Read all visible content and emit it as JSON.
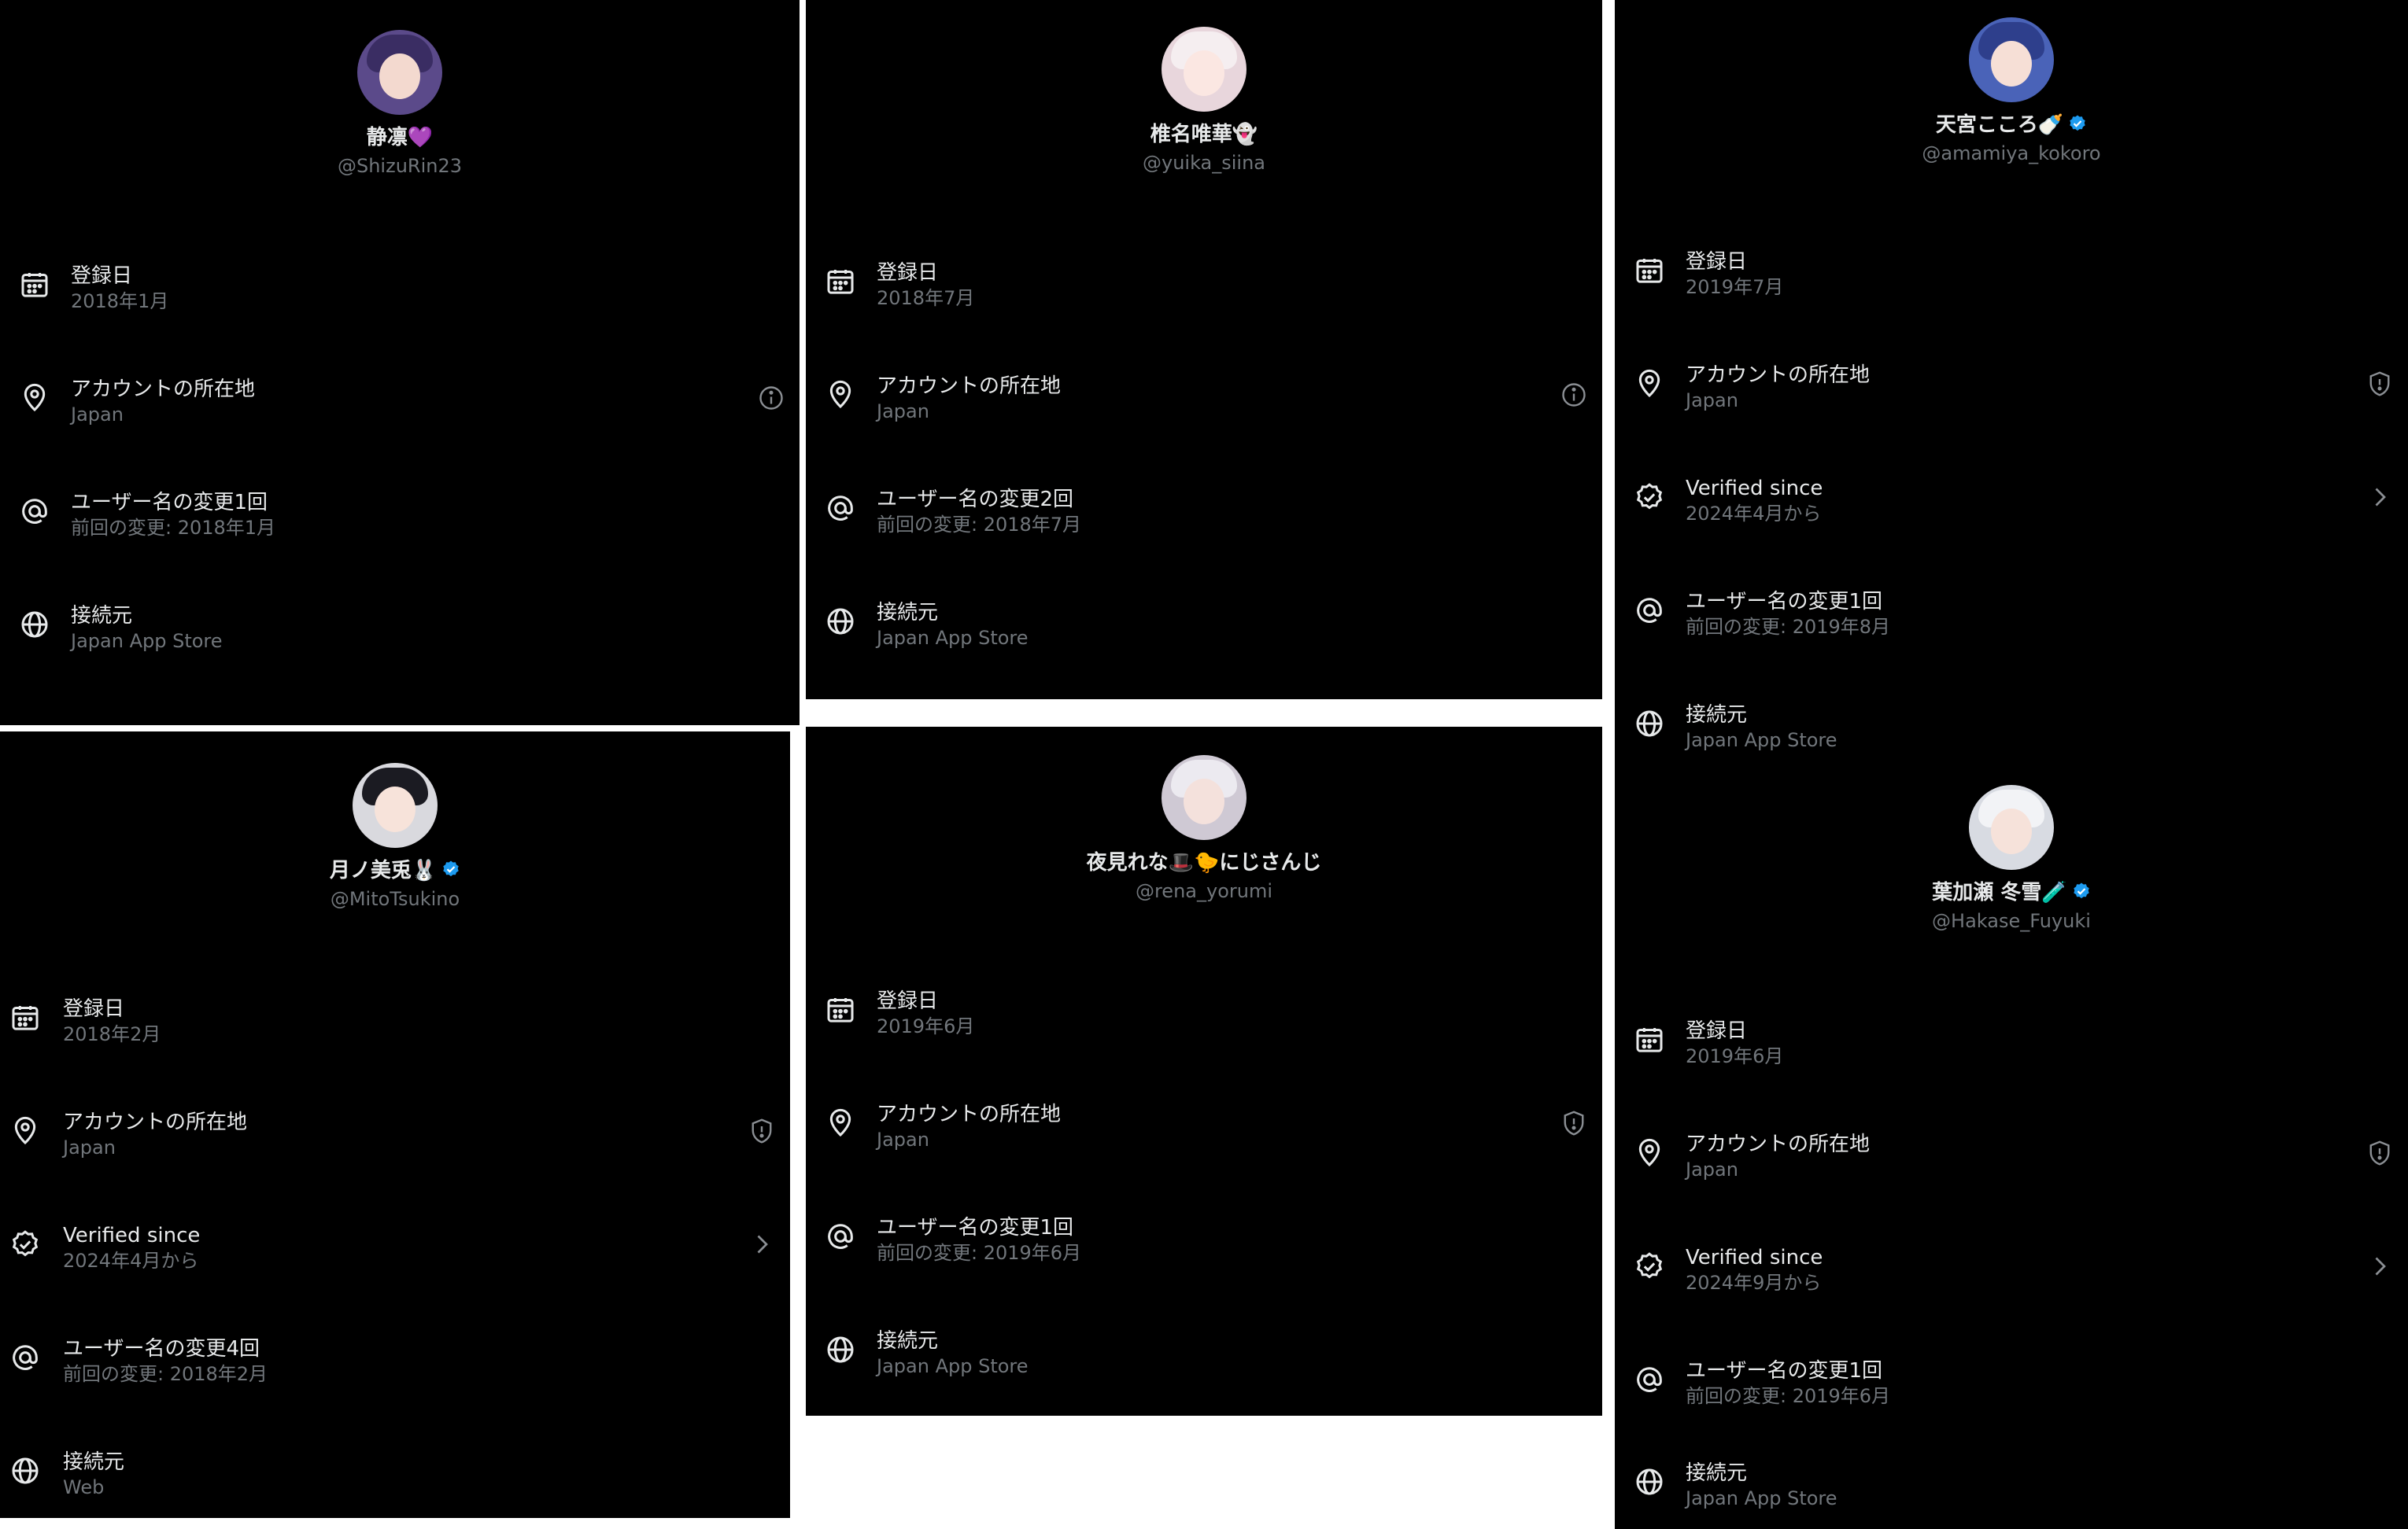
{
  "labels": {
    "joined": "登録日",
    "location": "アカウントの所在地",
    "verified": "Verified since",
    "connected": "接続元"
  },
  "profiles": [
    {
      "display_name": "静凛💜",
      "handle": "@ShizuRin23",
      "joined": "2018年1月",
      "location": "Japan",
      "username_changes": "ユーザー名の変更1回",
      "last_change": "前回の変更: 2018年1月",
      "connected_via": "Japan App Store"
    },
    {
      "display_name": "椎名唯華👻",
      "handle": "@yuika_siina",
      "joined": "2018年7月",
      "location": "Japan",
      "username_changes": "ユーザー名の変更2回",
      "last_change": "前回の変更: 2018年7月",
      "connected_via": "Japan App Store"
    },
    {
      "display_name": "天宮こころ🍼",
      "handle": "@amamiya_kokoro",
      "joined": "2019年7月",
      "location": "Japan",
      "verified_since": "2024年4月から",
      "username_changes": "ユーザー名の変更1回",
      "last_change": "前回の変更: 2019年8月",
      "connected_via": "Japan App Store"
    },
    {
      "display_name": "月ノ美兎🐰",
      "handle": "@MitoTsukino",
      "joined": "2018年2月",
      "location": "Japan",
      "verified_since": "2024年4月から",
      "username_changes": "ユーザー名の変更4回",
      "last_change": "前回の変更: 2018年2月",
      "connected_via": "Web"
    },
    {
      "display_name": "夜見れな🎩🐤にじさんじ",
      "handle": "@rena_yorumi",
      "joined": "2019年6月",
      "location": "Japan",
      "username_changes": "ユーザー名の変更1回",
      "last_change": "前回の変更: 2019年6月",
      "connected_via": "Japan App Store"
    },
    {
      "display_name": "葉加瀬 冬雪🧪",
      "handle": "@Hakase_Fuyuki",
      "joined": "2019年6月",
      "location": "Japan",
      "verified_since": "2024年9月から",
      "username_changes": "ユーザー名の変更1回",
      "last_change": "前回の変更: 2019年6月",
      "connected_via": "Japan App Store"
    }
  ],
  "icons": {
    "joined": "calendar-icon",
    "location": "location-pin-icon",
    "location_trailing": [
      "info-icon",
      "info-icon",
      "shield-icon",
      "shield-icon",
      "shield-icon",
      "shield-icon"
    ],
    "verified": "verified-check-icon",
    "verified_trailing": "chevron-right-icon",
    "username": "at-sign-icon",
    "connected": "globe-icon",
    "badge": "verified-badge-icon"
  },
  "colors": {
    "background": "#000000",
    "primary_text": "#e7e9ea",
    "secondary_text": "#71767b",
    "verified_badge": "#1d9bf0"
  }
}
